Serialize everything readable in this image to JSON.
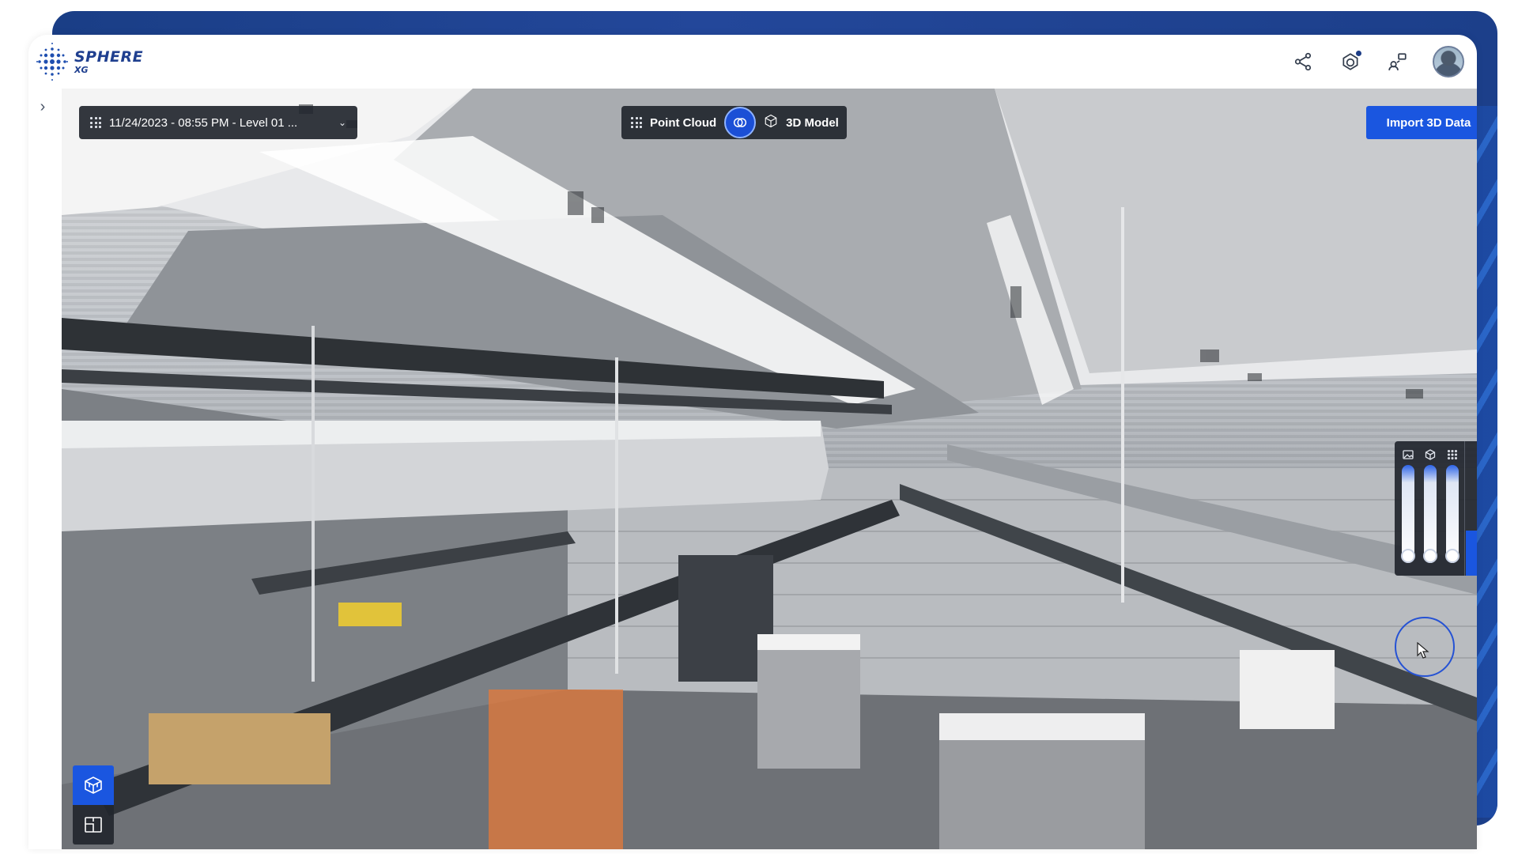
{
  "app": {
    "logo_title": "SPHERE",
    "logo_subtitle": "XG"
  },
  "header": {
    "icons": [
      "share-icon",
      "viewer-notification-icon",
      "users-icon",
      "avatar"
    ]
  },
  "sidebar": {
    "collapse_icon": "chevron-right-icon",
    "collapse_glyph": "›"
  },
  "toolbar": {
    "level_selector": "11/24/2023 - 08:55 PM - Level 01 ...",
    "mode_left": "Point Cloud",
    "mode_right": "3D Model",
    "import_button": "Import 3D Data"
  },
  "visibility_panel": {
    "sliders": [
      {
        "icon": "image-icon",
        "level": 0.0
      },
      {
        "icon": "cube-icon",
        "level": 0.0
      },
      {
        "icon": "point-grid-icon",
        "level": 0.0
      }
    ],
    "buttons": [
      "clipping-box-icon",
      "cube-icon",
      "light-icon"
    ],
    "active_button": "light-icon"
  },
  "view_tools": {
    "buttons": [
      "3d-view-icon",
      "floor-plan-icon"
    ],
    "active": "3d-view-icon"
  },
  "colors": {
    "accent": "#1a56e0",
    "brand": "#1f3f8f",
    "panel": "#22262e",
    "frame": "#1d3f8a"
  }
}
